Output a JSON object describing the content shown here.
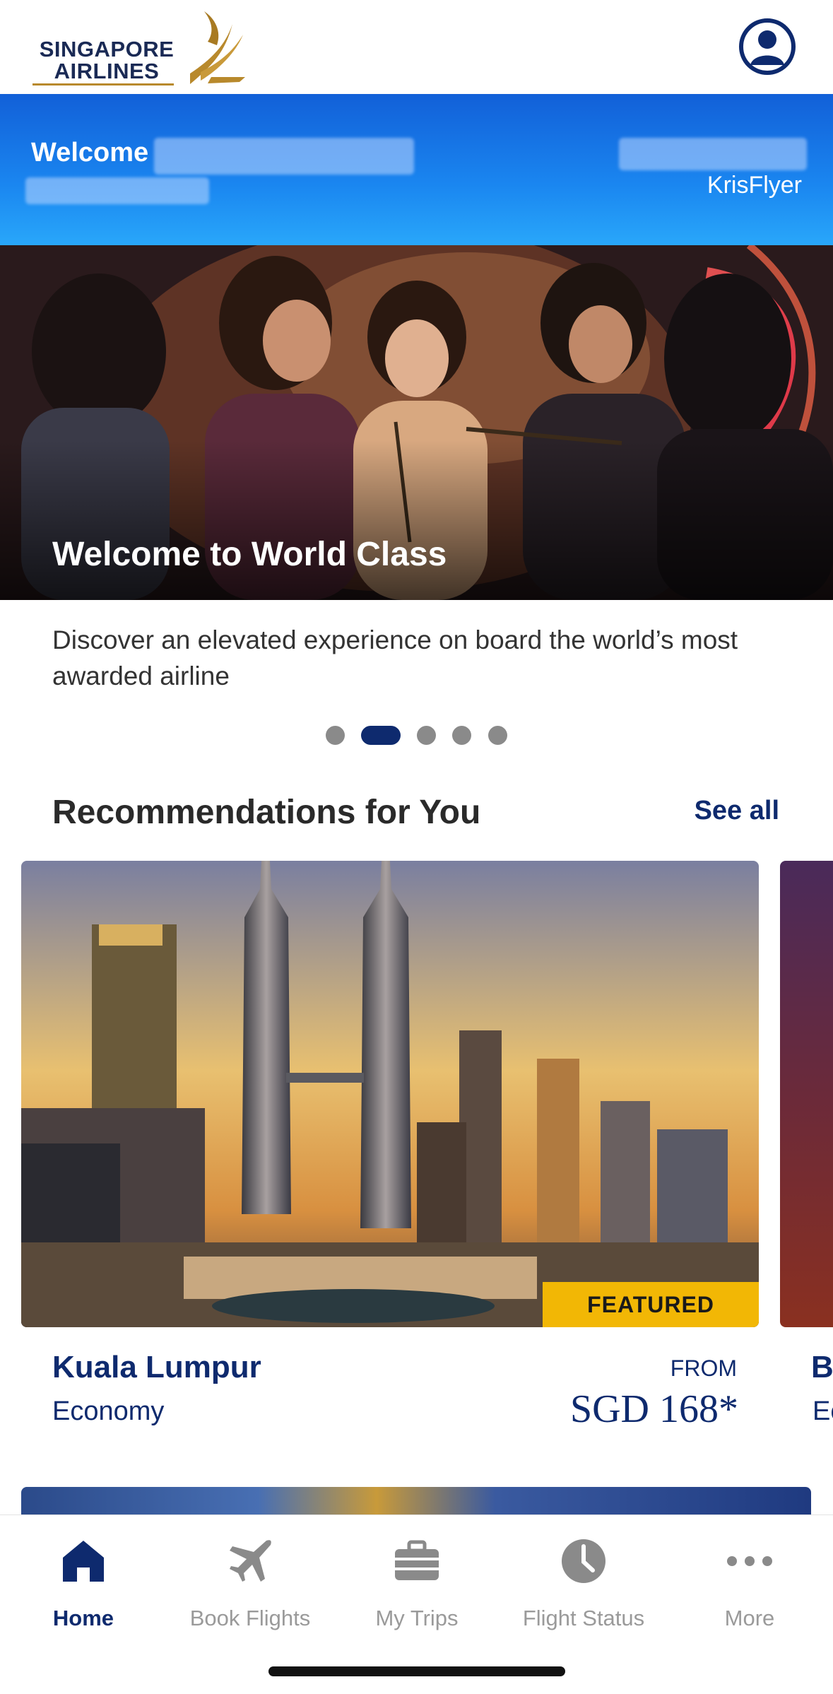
{
  "header": {
    "logo_line1": "SINGAPORE",
    "logo_line2": "AIRLINES",
    "brand_gold": "#b8892c",
    "brand_navy": "#1a2a55",
    "profile_icon": "user-circle-icon"
  },
  "welcome": {
    "greeting": "Welcome",
    "membership": "KrisFlyer"
  },
  "hero": {
    "title": "Welcome to World Class",
    "description": "Discover an elevated experience on board the world’s most awarded airline",
    "slide_count": 5,
    "active_slide": 2
  },
  "recommendations": {
    "title": "Recommendations for You",
    "see_all": "See all",
    "cards": [
      {
        "badge": "FEATURED",
        "destination": "Kuala Lumpur",
        "cabin": "Economy",
        "from_label": "FROM",
        "price": "SGD 168*"
      },
      {
        "destination": "B",
        "cabin": "Ec"
      }
    ]
  },
  "tabs": [
    {
      "label": "Home",
      "icon": "home-icon",
      "active": true
    },
    {
      "label": "Book Flights",
      "icon": "plane-icon",
      "active": false
    },
    {
      "label": "My Trips",
      "icon": "briefcase-icon",
      "active": false
    },
    {
      "label": "Flight Status",
      "icon": "clock-icon",
      "active": false
    },
    {
      "label": "More",
      "icon": "more-dots-icon",
      "active": false
    }
  ],
  "colors": {
    "accent_navy": "#0e2a6e",
    "featured_yellow": "#f2b705",
    "banner_blue": "#1a86f0"
  }
}
